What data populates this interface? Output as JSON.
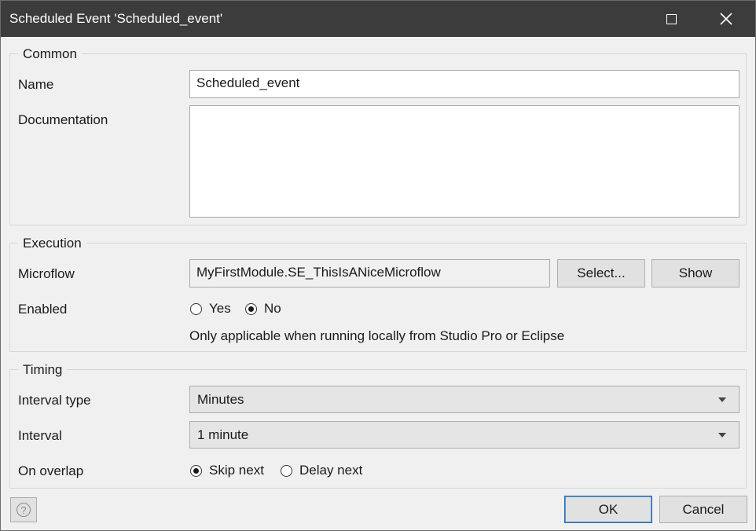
{
  "window": {
    "title": "Scheduled Event 'Scheduled_event'"
  },
  "common": {
    "legend": "Common",
    "name_label": "Name",
    "name_value": "Scheduled_event",
    "documentation_label": "Documentation",
    "documentation_value": ""
  },
  "execution": {
    "legend": "Execution",
    "microflow_label": "Microflow",
    "microflow_value": "MyFirstModule.SE_ThisIsANiceMicroflow",
    "select_button": "Select...",
    "show_button": "Show",
    "enabled_label": "Enabled",
    "enabled_options": [
      "Yes",
      "No"
    ],
    "enabled_selected": "No",
    "note": "Only applicable when running locally from Studio Pro or Eclipse"
  },
  "timing": {
    "legend": "Timing",
    "interval_type_label": "Interval type",
    "interval_type_value": "Minutes",
    "interval_label": "Interval",
    "interval_value": "1 minute",
    "overlap_label": "On overlap",
    "overlap_options": [
      "Skip next",
      "Delay next"
    ],
    "overlap_selected": "Skip next"
  },
  "footer": {
    "ok": "OK",
    "cancel": "Cancel",
    "help_glyph": "?"
  },
  "icons": {
    "maximize": "maximize-icon",
    "close": "close-icon",
    "help": "help-icon",
    "dropdown": "chevron-down-icon"
  }
}
